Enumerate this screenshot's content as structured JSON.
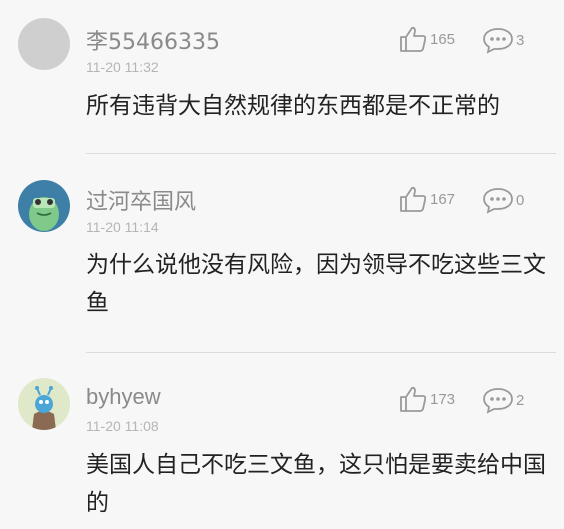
{
  "comments": [
    {
      "username": "李55466335",
      "time": "11-20 11:32",
      "text": "所有违背大自然规律的东西都是不正常的",
      "likes": "165",
      "replies": "3"
    },
    {
      "username": "过河卒国风",
      "time": "11-20 11:14",
      "text": "为什么说他没有风险，因为领导不吃这些三文鱼",
      "likes": "167",
      "replies": "0"
    },
    {
      "username": "byhyew",
      "time": "11-20 11:08",
      "text": "美国人自己不吃三文鱼，这只怕是要卖给中国的",
      "likes": "173",
      "replies": "2"
    }
  ],
  "icons": {
    "like": "thumbs-up-icon",
    "reply": "speech-bubble-icon"
  }
}
